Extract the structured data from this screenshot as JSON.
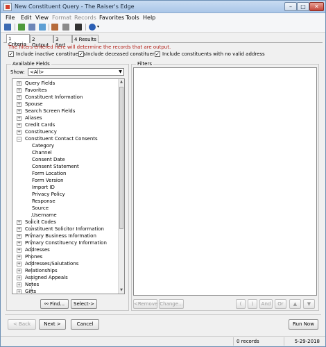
{
  "window": {
    "title": "New Constituent Query - The Raiser's Edge"
  },
  "menu": {
    "file": "File",
    "edit": "Edit",
    "view": "View",
    "format": "Format",
    "records": "Records",
    "favorites": "Favorites",
    "tools": "Tools",
    "help": "Help"
  },
  "tabs": [
    "1 Criteria",
    "2 Output",
    "3 Sort",
    "4 Results"
  ],
  "filter_note": "The filters entered here will determine the records that are output.",
  "options": {
    "inactive": "Include inactive constituents",
    "deceased": "Include deceased constituents",
    "no_address": "Include constituents with no valid address"
  },
  "available": {
    "title": "Available Fields",
    "show_label": "Show:",
    "show_value": "<All>",
    "tree": [
      "Query Fields",
      "Favorites",
      "Constituent Information",
      "Spouse",
      "Search Screen Fields",
      "Aliases",
      "Credit Cards",
      "Constituency",
      "Constituent Contact Consents",
      "Category",
      "Channel",
      "Consent Date",
      "Consent Statement",
      "Form Location",
      "Form Version",
      "Import ID",
      "Privacy Policy",
      "Response",
      "Source",
      "Username",
      "Solicit Codes",
      "Constituent Solicitor Information",
      "Primary Business Information",
      "Primary Constituency Information",
      "Addresses",
      "Phones",
      "Addresses/Salutations",
      "Relationships",
      "Assigned Appeals",
      "Notes",
      "Gifts"
    ],
    "find_button": "Find...",
    "select_button": "Select->"
  },
  "filters": {
    "title": "Filters",
    "remove_button": "<Remove",
    "change_button": "Change...",
    "paren_open": "(",
    "paren_close": ")",
    "and_button": "And",
    "or_button": "Or"
  },
  "footer": {
    "back_button": "< Back",
    "next_button": "Next >",
    "cancel_button": "Cancel",
    "run_button": "Run Now"
  },
  "status": {
    "records": "0 records",
    "date": "5-29-2018"
  }
}
